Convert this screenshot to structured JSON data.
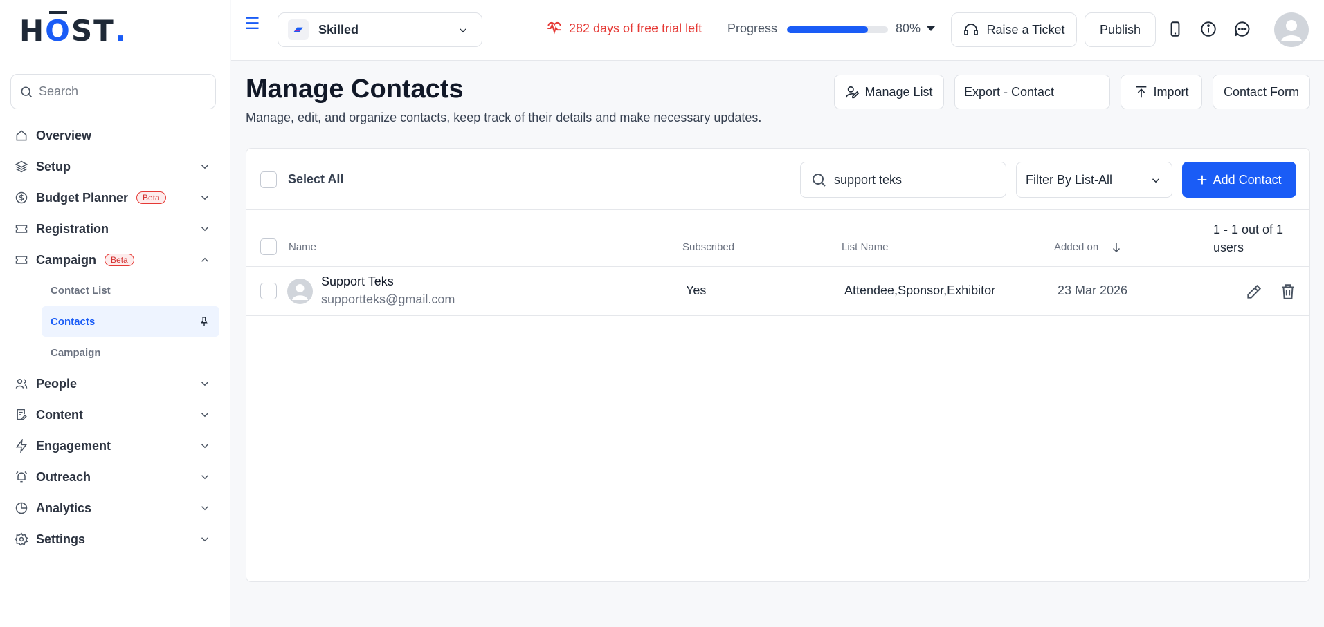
{
  "sidebar": {
    "logo": {
      "h": "H",
      "o": "O",
      "st": "ST",
      "dot": "."
    },
    "search_placeholder": "Search",
    "items": [
      {
        "label": "Overview",
        "icon": "home-icon"
      },
      {
        "label": "Setup",
        "icon": "layers-icon"
      },
      {
        "label": "Budget Planner",
        "icon": "dollar-circle-icon",
        "badge": "Beta"
      },
      {
        "label": "Registration",
        "icon": "ticket-icon"
      },
      {
        "label": "Campaign",
        "icon": "ticket-icon",
        "badge": "Beta"
      },
      {
        "label": "People",
        "icon": "users-icon"
      },
      {
        "label": "Content",
        "icon": "file-edit-icon"
      },
      {
        "label": "Engagement",
        "icon": "lightning-icon"
      },
      {
        "label": "Outreach",
        "icon": "bell-icon"
      },
      {
        "label": "Analytics",
        "icon": "pie-chart-icon"
      },
      {
        "label": "Settings",
        "icon": "gear-icon"
      }
    ],
    "sub_items": [
      {
        "label": "Contact List"
      },
      {
        "label": "Contacts"
      },
      {
        "label": "Campaign"
      }
    ]
  },
  "topbar": {
    "event_name": "Skilled",
    "trial_text": "282 days of free trial left",
    "progress_label": "Progress",
    "progress_value": "80%",
    "progress_fraction": 0.8,
    "raise_ticket": "Raise a Ticket",
    "publish": "Publish"
  },
  "page": {
    "title": "Manage Contacts",
    "subtitle": "Manage, edit, and organize contacts, keep track of their details and make necessary updates.",
    "actions": {
      "manage_list": "Manage List",
      "export": "Export - Contact",
      "import": "Import",
      "contact_form": "Contact Form"
    }
  },
  "table": {
    "select_all": "Select All",
    "search_value": "support teks",
    "filter": "Filter By List-All",
    "add_contact": "Add Contact",
    "headers": {
      "name": "Name",
      "subscribed": "Subscribed",
      "list_name": "List Name",
      "added_on": "Added on"
    },
    "count": "1 - 1 out of 1 users",
    "rows": [
      {
        "name": "Support Teks",
        "email": "supportteks@gmail.com",
        "subscribed": "Yes",
        "list_name": "Attendee,Sponsor,Exhibitor",
        "added_on": "23 Mar 2026"
      }
    ]
  },
  "colors": {
    "accent": "#1a5cf6",
    "trial": "#e53935",
    "badge": "#d32f2f"
  }
}
